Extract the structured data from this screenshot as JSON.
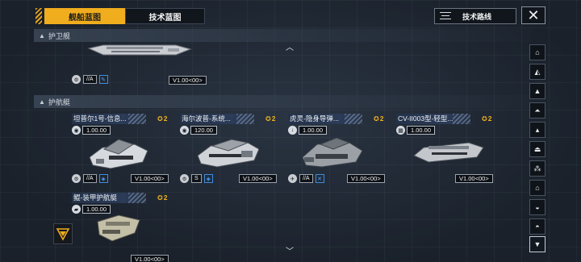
{
  "tabs": {
    "active": "舰船蓝图",
    "inactive": "技术蓝图"
  },
  "route_button": {
    "label": "技术路线"
  },
  "close_button": {
    "label": "✕"
  },
  "sections": [
    {
      "label": "护卫舰",
      "toggle_icon": "▲"
    },
    {
      "label": "护航艇",
      "toggle_icon": "▲"
    }
  ],
  "escort_top": {
    "attr_tag": "//A",
    "version": "V1.00<00>"
  },
  "ships": [
    {
      "name": "坦普尔1号-信息...",
      "rank": "2",
      "cost": "1.00.00",
      "attr_tag": "//A",
      "version": "V1.00<00>"
    },
    {
      "name": "海尔波普-系统...",
      "rank": "2",
      "cost": "120.00",
      "attr_tag": "S",
      "version": "V1.00<00>"
    },
    {
      "name": "虎灵-隐身导弹...",
      "rank": "2",
      "cost": "1.00.00",
      "attr_tag": "//A",
      "version": "V1.00<00>"
    },
    {
      "name": "CV-II003型-轻型...",
      "rank": "2",
      "cost": "1.00.00",
      "attr_tag": "",
      "version": "V1.00<00>"
    },
    {
      "name": "鲲-装甲护航艇",
      "rank": "2",
      "cost": "1.00.00",
      "attr_tag": "",
      "version": "V1.00<00>"
    }
  ],
  "sidebar_icons": [
    "hangar-icon",
    "carrier-icon",
    "cruiser-icon",
    "destroyer-icon",
    "frigate-icon",
    "corvette-icon",
    "fighter-icon",
    "aux-icon",
    "station-icon",
    "misc-icon",
    "filter-icon"
  ],
  "colors": {
    "accent": "#f0ad1e",
    "rank": "#f0b21e",
    "bg": "#1c2430"
  }
}
